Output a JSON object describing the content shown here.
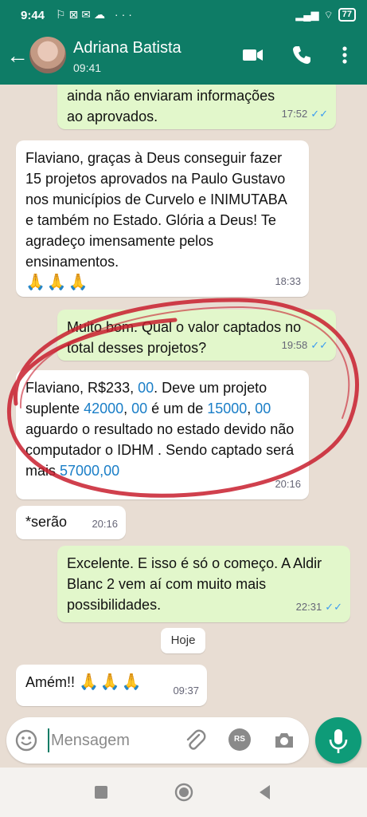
{
  "status": {
    "time": "9:44",
    "battery": "77"
  },
  "header": {
    "name": "Adriana Batista",
    "subtitle": "09:41"
  },
  "messages": [
    {
      "dir": "out",
      "text": "ainda não enviaram informações ao aprovados.",
      "time": "17:52"
    },
    {
      "dir": "in",
      "text": "Flaviano, graças à Deus conseguir fazer 15 projetos aprovados na Paulo Gustavo  nos municípios de Curvelo e INIMUTABA e também no Estado. Glória a Deus! Te agradeço imensamente pelos ensinamentos.",
      "emoji": "🙏🙏🙏",
      "time": "18:33"
    },
    {
      "dir": "out",
      "text": "Muito bom. Qual o valor captados no total desses projetos?",
      "time": "19:58"
    },
    {
      "dir": "in",
      "parts": [
        "Flaviano, R$233, ",
        "00",
        ". Deve um projeto suplente ",
        "42000",
        ", ",
        "00",
        " é um de ",
        "15000",
        ", ",
        "00",
        " aguardo o resultado no estado devido não computador o IDHM . Sendo captado será mais ",
        "57000,00"
      ],
      "time": "20:16"
    },
    {
      "dir": "in",
      "text": "*serão",
      "time": "20:16"
    },
    {
      "dir": "out",
      "text": "Excelente. E isso é só o começo. A Aldir Blanc 2 vem aí com muito mais possibilidades.",
      "time": "22:31"
    },
    {
      "dir": "in",
      "text": "Amém!!",
      "emoji": "🙏🙏🙏",
      "time": "09:37"
    }
  ],
  "date_chip": "Hoje",
  "composer": {
    "placeholder": "Mensagem",
    "rs_label": "RS"
  },
  "colors": {
    "header": "#0e7c66",
    "outgoing": "#e2f7cb",
    "incoming": "#ffffff",
    "annotation": "#c81e2e",
    "mic": "#0e9b78"
  },
  "icons": [
    "back-arrow-icon",
    "video-call-icon",
    "phone-icon",
    "more-options-icon",
    "emoji-icon",
    "attach-icon",
    "camera-icon",
    "mic-icon",
    "double-check-icon"
  ]
}
